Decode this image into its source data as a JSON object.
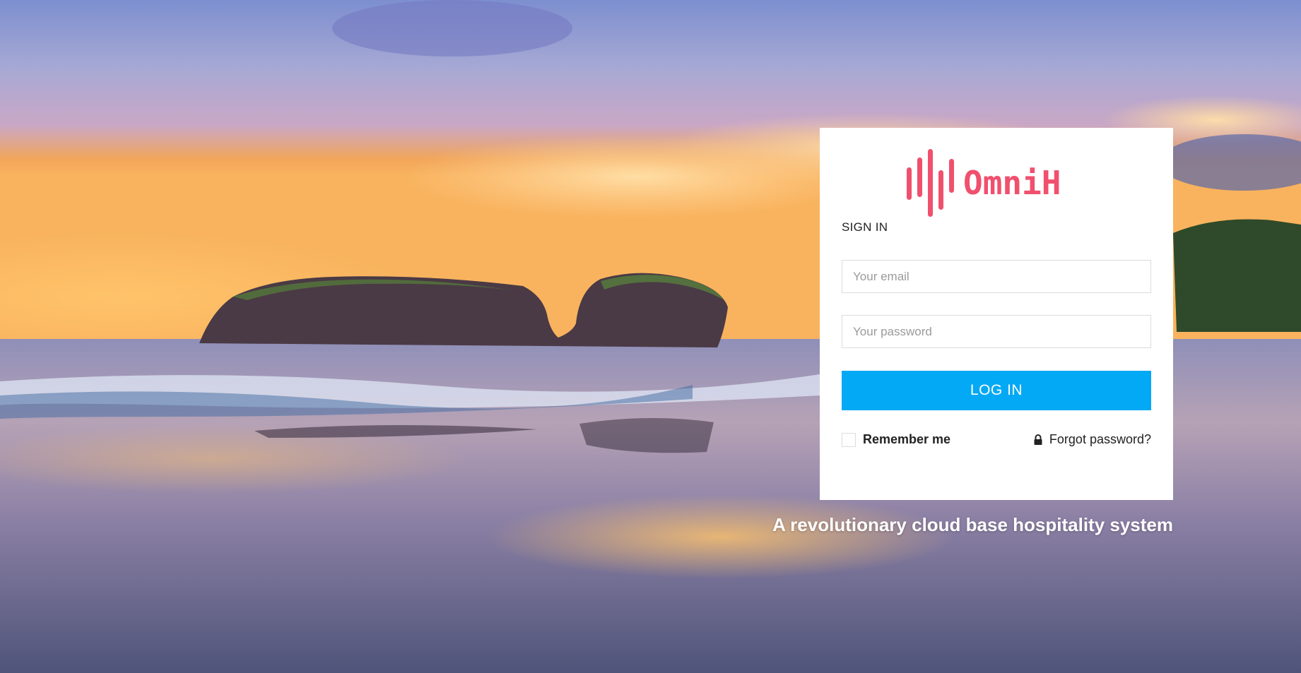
{
  "background": {
    "description_icon": "beach-sunset-background"
  },
  "brand": {
    "name": "OmniH",
    "color": "#f0506e",
    "icon": "sound-bars-logo-icon"
  },
  "login": {
    "heading": "SIGN IN",
    "email_placeholder": "Your email",
    "email_value": "",
    "password_placeholder": "Your password",
    "password_value": "",
    "submit_label": "LOG IN",
    "submit_color": "#03a9f4",
    "remember_label": "Remember me",
    "remember_checked": false,
    "forgot_label": "Forgot password?",
    "forgot_icon": "lock-icon"
  },
  "tagline": "A revolutionary cloud base hospitality system"
}
